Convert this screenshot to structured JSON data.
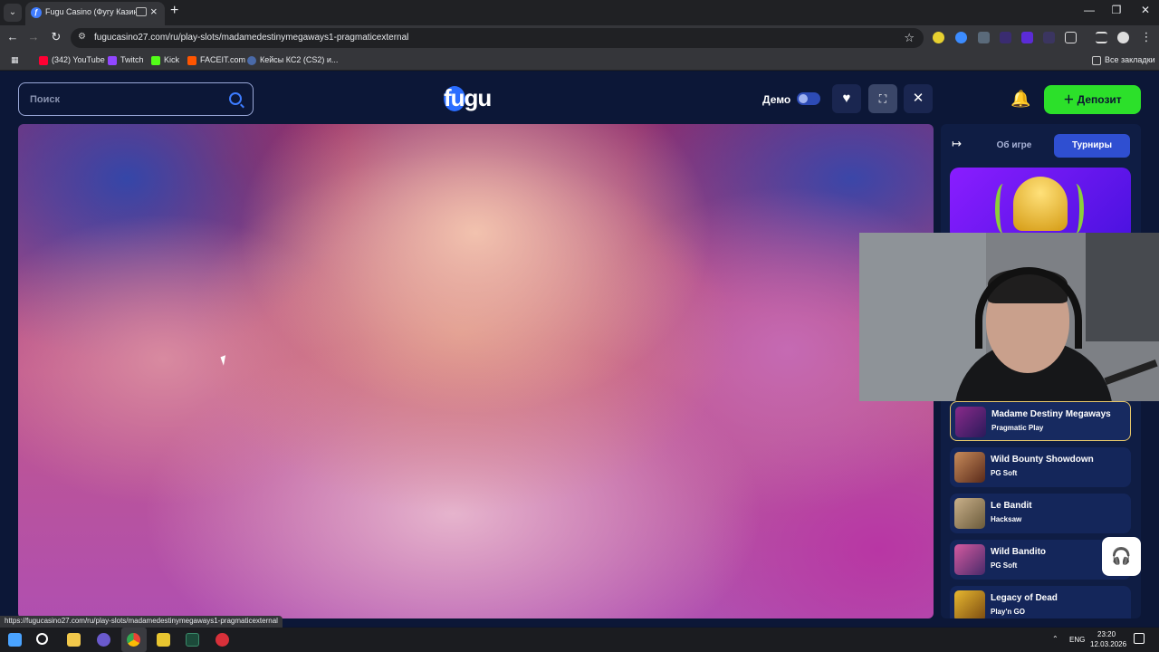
{
  "browser": {
    "tab_title": "Fugu Casino (Фугу Казино)",
    "url": "fugucasino27.com/ru/play-slots/madamedestinymegaways1-pragmaticexternal",
    "bookmarks": [
      "(342) YouTube",
      "Twitch",
      "Kick",
      "FACEIT.com",
      "Кейсы КС2 (CS2) и..."
    ],
    "all_bookmarks": "Все закладки",
    "status_url": "https://fugucasino27.com/ru/play-slots/madamedestinymegaways1-pragmaticexternal"
  },
  "header": {
    "search_placeholder": "Поиск",
    "logo": "fugu",
    "demo_label": "Демо",
    "deposit_label": "Депозит"
  },
  "sidepanel": {
    "tabs": [
      "Об игре",
      "Турниры"
    ],
    "active_tab": "Турниры",
    "games": [
      {
        "title": "Madame Destiny Megaways",
        "provider": "Pragmatic Play",
        "active": true
      },
      {
        "title": "Wild Bounty Showdown",
        "provider": "PG Soft",
        "active": false
      },
      {
        "title": "Le Bandit",
        "provider": "Hacksaw",
        "active": false
      },
      {
        "title": "Wild Bandito",
        "provider": "PG Soft",
        "active": false
      },
      {
        "title": "Legacy of Dead",
        "provider": "Play'n GO",
        "active": false
      }
    ]
  },
  "taskbar": {
    "lang": "ENG",
    "time": "23:20",
    "date": "12.03.2026"
  },
  "colors": {
    "site_bg": "#0c1737",
    "accent_blue": "#2a6dff",
    "deposit_green": "#2ce02a",
    "active_tab": "#2f4fd1"
  }
}
